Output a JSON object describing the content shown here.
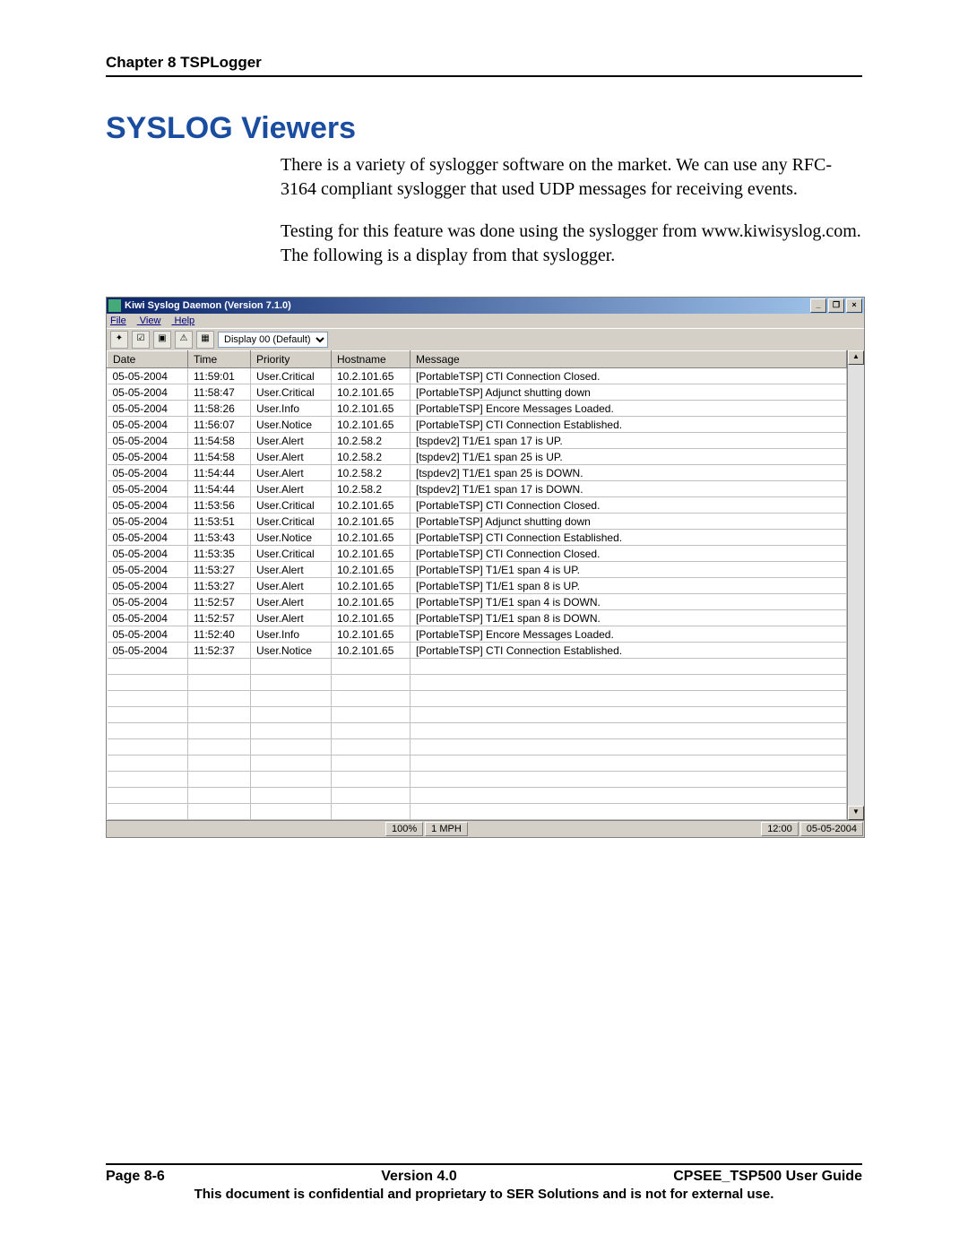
{
  "chapter_header": "Chapter 8 TSPLogger",
  "section_title": "SYSLOG Viewers",
  "paragraphs": {
    "p1": "There is a variety of syslogger software on the market.  We can use any RFC-3164 compliant syslogger that used UDP messages for receiving events.",
    "p2": "Testing for this feature was done using the syslogger from www.kiwisyslog.com.  The following is a display from that syslogger."
  },
  "app": {
    "title": "Kiwi Syslog Daemon (Version 7.1.0)",
    "menus": {
      "file": "File",
      "view": "View",
      "help": "Help"
    },
    "display_dropdown": "Display 00 (Default)",
    "columns": {
      "date": "Date",
      "time": "Time",
      "priority": "Priority",
      "hostname": "Hostname",
      "message": "Message"
    },
    "rows": [
      {
        "date": "05-05-2004",
        "time": "11:59:01",
        "priority": "User.Critical",
        "host": "10.2.101.65",
        "msg": "[PortableTSP] CTI Connection Closed."
      },
      {
        "date": "05-05-2004",
        "time": "11:58:47",
        "priority": "User.Critical",
        "host": "10.2.101.65",
        "msg": "[PortableTSP] Adjunct shutting down"
      },
      {
        "date": "05-05-2004",
        "time": "11:58:26",
        "priority": "User.Info",
        "host": "10.2.101.65",
        "msg": "[PortableTSP] Encore Messages Loaded."
      },
      {
        "date": "05-05-2004",
        "time": "11:56:07",
        "priority": "User.Notice",
        "host": "10.2.101.65",
        "msg": "[PortableTSP] CTI Connection Established."
      },
      {
        "date": "05-05-2004",
        "time": "11:54:58",
        "priority": "User.Alert",
        "host": "10.2.58.2",
        "msg": "[tspdev2] T1/E1 span 17 is UP."
      },
      {
        "date": "05-05-2004",
        "time": "11:54:58",
        "priority": "User.Alert",
        "host": "10.2.58.2",
        "msg": "[tspdev2] T1/E1 span 25 is UP."
      },
      {
        "date": "05-05-2004",
        "time": "11:54:44",
        "priority": "User.Alert",
        "host": "10.2.58.2",
        "msg": "[tspdev2] T1/E1 span 25 is DOWN."
      },
      {
        "date": "05-05-2004",
        "time": "11:54:44",
        "priority": "User.Alert",
        "host": "10.2.58.2",
        "msg": "[tspdev2] T1/E1 span 17 is DOWN."
      },
      {
        "date": "05-05-2004",
        "time": "11:53:56",
        "priority": "User.Critical",
        "host": "10.2.101.65",
        "msg": "[PortableTSP] CTI Connection Closed."
      },
      {
        "date": "05-05-2004",
        "time": "11:53:51",
        "priority": "User.Critical",
        "host": "10.2.101.65",
        "msg": "[PortableTSP] Adjunct shutting down"
      },
      {
        "date": "05-05-2004",
        "time": "11:53:43",
        "priority": "User.Notice",
        "host": "10.2.101.65",
        "msg": "[PortableTSP] CTI Connection Established."
      },
      {
        "date": "05-05-2004",
        "time": "11:53:35",
        "priority": "User.Critical",
        "host": "10.2.101.65",
        "msg": "[PortableTSP] CTI Connection Closed."
      },
      {
        "date": "05-05-2004",
        "time": "11:53:27",
        "priority": "User.Alert",
        "host": "10.2.101.65",
        "msg": "[PortableTSP] T1/E1 span  4 is UP."
      },
      {
        "date": "05-05-2004",
        "time": "11:53:27",
        "priority": "User.Alert",
        "host": "10.2.101.65",
        "msg": "[PortableTSP] T1/E1 span  8 is UP."
      },
      {
        "date": "05-05-2004",
        "time": "11:52:57",
        "priority": "User.Alert",
        "host": "10.2.101.65",
        "msg": "[PortableTSP] T1/E1 span  4 is DOWN."
      },
      {
        "date": "05-05-2004",
        "time": "11:52:57",
        "priority": "User.Alert",
        "host": "10.2.101.65",
        "msg": "[PortableTSP] T1/E1 span  8 is DOWN."
      },
      {
        "date": "05-05-2004",
        "time": "11:52:40",
        "priority": "User.Info",
        "host": "10.2.101.65",
        "msg": "[PortableTSP] Encore Messages Loaded."
      },
      {
        "date": "05-05-2004",
        "time": "11:52:37",
        "priority": "User.Notice",
        "host": "10.2.101.65",
        "msg": "[PortableTSP] CTI Connection Established."
      }
    ],
    "empty_rows": 10,
    "status": {
      "percent": "100%",
      "mph": "1 MPH",
      "time": "12:00",
      "date": "05-05-2004"
    }
  },
  "footer": {
    "page": "Page 8-6",
    "version": "Version 4.0",
    "guide": "CPSEE_TSP500 User Guide",
    "confidential": "This document is confidential and proprietary to SER Solutions and is not for external use."
  }
}
